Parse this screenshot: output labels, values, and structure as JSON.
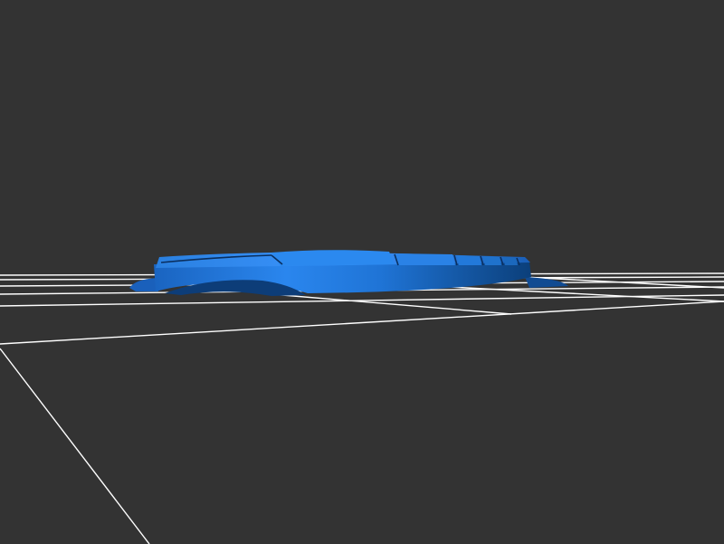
{
  "scene": {
    "background_color": "#333333",
    "grid_color": "#ffffff",
    "model_color": "#1f78d6",
    "model_shadow_color": "#0b3f7a",
    "model_highlight_color": "#3b95ff"
  }
}
